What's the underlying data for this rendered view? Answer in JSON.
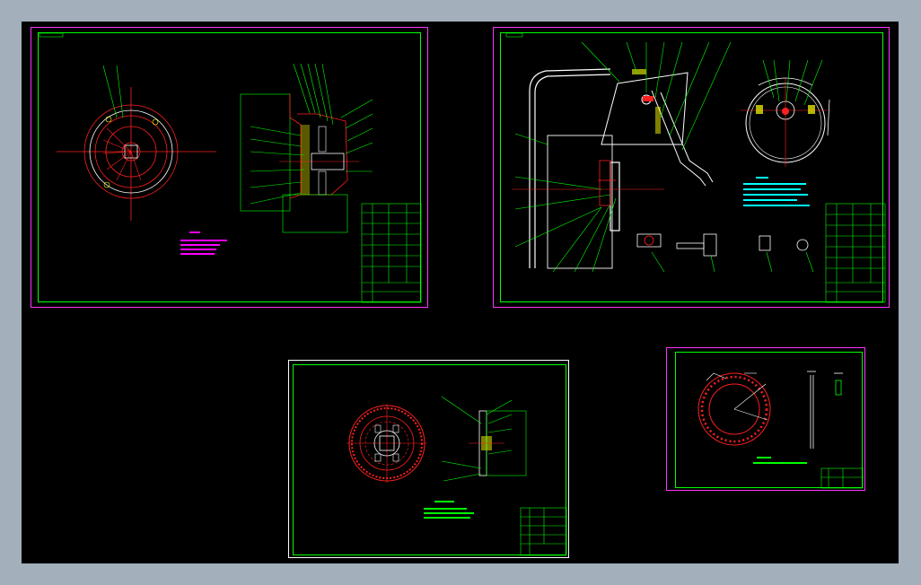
{
  "colors": {
    "frame_bg": "#a3afbb",
    "canvas_bg": "#000000",
    "sheet_border": "#ff33ff",
    "drawing_line": "#00ff00",
    "part_outline": "#ff2020",
    "note_text": "#ff00ff",
    "highlight_yellow": "#ffff00",
    "leader_white": "#ffffff"
  },
  "sheets": [
    {
      "name": "sheet-clutch-assembly"
    },
    {
      "name": "sheet-pedal-linkage"
    },
    {
      "name": "sheet-driven-disc"
    },
    {
      "name": "sheet-friction-plate"
    }
  ]
}
